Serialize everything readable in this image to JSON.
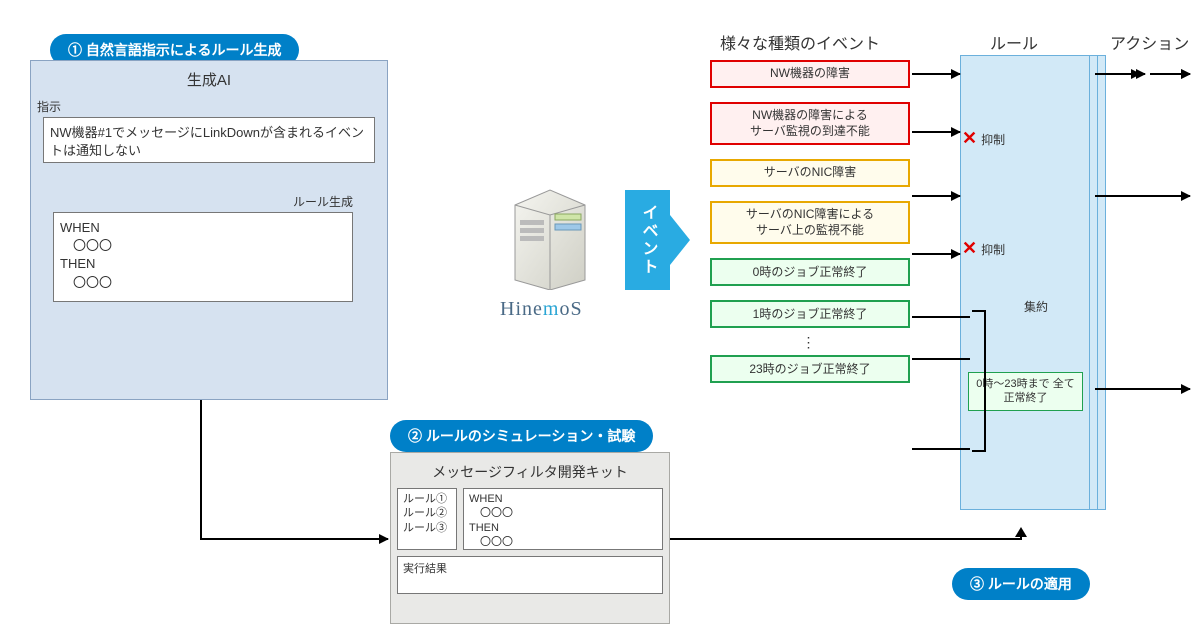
{
  "callouts": {
    "c1": "① 自然言語指示によるルール生成",
    "c2": "② ルールのシミュレーション・試験",
    "c3": "③ ルールの適用"
  },
  "ai": {
    "title": "生成AI",
    "instr_label": "指示",
    "instr_text": "NW機器#1でメッセージにLinkDownが含まれるイベントは通知しない",
    "rulegen_label": "ルール生成",
    "rulegen_text": "WHEN\n　〇〇〇\nTHEN\n　〇〇〇"
  },
  "hinemos_brand": "Hinemos",
  "event_label": "イベント",
  "dev": {
    "title": "メッセージフィルタ開発キット",
    "rules": "ルール①\nルール②\nルール③",
    "body": "WHEN\n　〇〇〇\nTHEN\n　〇〇〇",
    "result_label": "実行結果"
  },
  "headers": {
    "events": "様々な種類のイベント",
    "rule": "ルール",
    "action": "アクション"
  },
  "events": {
    "e1": "NW機器の障害",
    "e2": "NW機器の障害による\nサーバ監視の到達不能",
    "e3": "サーバのNIC障害",
    "e4": "サーバのNIC障害による\nサーバ上の監視不能",
    "e5": "0時のジョブ正常終了",
    "e6": "1時のジョブ正常終了",
    "e7": "23時のジョブ正常終了"
  },
  "rule_panel": {
    "suppress": "抑制",
    "aggregate_label": "集約",
    "aggregate_box": "0時～23時まで\n全て正常終了"
  }
}
